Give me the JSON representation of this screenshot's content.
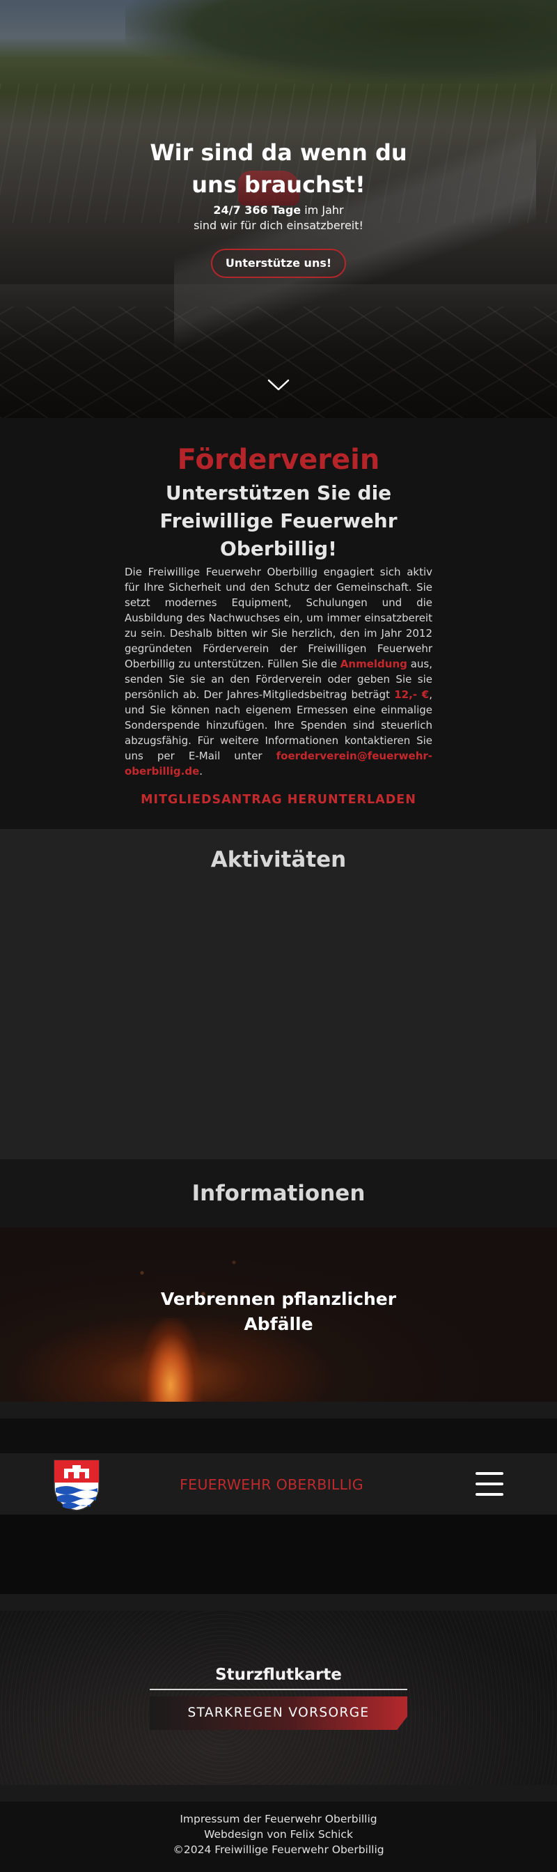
{
  "hero": {
    "headline_line1": "Wir sind da wenn du",
    "headline_line2": "uns brauchst!",
    "availability_bold": "24/7 366 Tage",
    "availability_rest": " im Jahr",
    "tagline": "sind wir für dich einsatzbereit!",
    "cta_label": "Unterstütze uns!",
    "scroll_icon": "chevron-down-icon"
  },
  "foerderverein": {
    "kicker": "Förderverein",
    "title_line1": "Unterstützen Sie die",
    "title_line2": "Freiwillige Feuerwehr",
    "title_line3": "Oberbillig!",
    "text_part1": "Die Freiwillige Feuerwehr Oberbillig engagiert sich aktiv für Ihre Sicherheit und den Schutz der Gemeinschaft. Sie setzt modernes Equipment, Schulungen und die Ausbildung des Nachwuchses ein, um immer einsatzbereit zu sein. Deshalb bitten wir Sie herzlich, den im Jahr 2012 gegründeten Förderverein der Freiwilligen Feuerwehr Oberbillig zu unterstützen. Füllen Sie die ",
    "anmeldung_link": "Anmeldung",
    "text_part2": " aus, senden Sie sie an den Förderverein oder geben Sie sie persönlich ab. Der Jahres-Mitgliedsbeitrag beträgt ",
    "fee": "12,- €",
    "text_part3": ", und Sie können nach eigenem Ermessen eine einmalige Sonderspende hinzufügen. Ihre Spenden sind steuerlich abzugsfähig. Für weitere Informationen kontaktieren Sie uns per E-Mail unter ",
    "email": "foerderverein@feuerwehr-oberbillig.de",
    "text_part4": ".",
    "download_label": "MITGLIEDSANTRAG HERUNTERLADEN"
  },
  "aktivitaeten": {
    "title": "Aktivitäten"
  },
  "informationen": {
    "title": "Informationen",
    "card_title_line1": "Verbrennen pflanzlicher",
    "card_title_line2": "Abfälle"
  },
  "nav": {
    "logo_icon": "coat-of-arms-icon",
    "brand": "FEUERWEHR OBERBILLIG",
    "menu_icon": "hamburger-menu-icon"
  },
  "sturzflut": {
    "title": "Sturzflutkarte",
    "button_label": "STARKREGEN VORSORGE"
  },
  "footer": {
    "impressum": "Impressum der Feuerwehr Oberbillig",
    "webdesign": "Webdesign von Felix Schick",
    "copyright": "©2024 Freiwillige Feuerwehr Oberbillig"
  },
  "colors": {
    "accent_red": "#b52428",
    "dark_bg": "#131313",
    "section_bg": "#222222"
  }
}
